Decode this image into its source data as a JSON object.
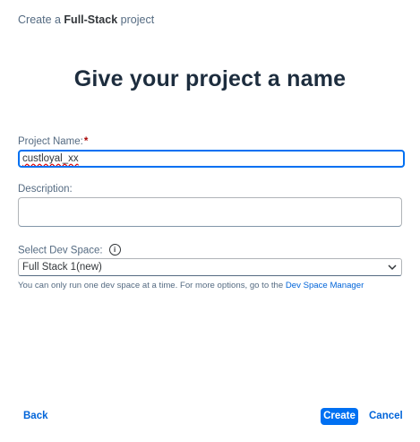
{
  "header": {
    "prefix": "Create a ",
    "bold": "Full-Stack",
    "suffix": " project"
  },
  "page_title": "Give your project a name",
  "project_name": {
    "label": "Project Name:",
    "required_marker": "*",
    "value": "custloyal_xx"
  },
  "description": {
    "label": "Description:",
    "value": ""
  },
  "dev_space": {
    "label": "Select Dev Space:",
    "info_icon": "i",
    "selected": "Full Stack 1(new)",
    "hint_text": "You can only run one dev space at a time. For more options, go to the ",
    "hint_link": "Dev Space Manager"
  },
  "footer": {
    "back": "Back",
    "create": "Create",
    "cancel": "Cancel"
  },
  "colors": {
    "accent": "#0070f2",
    "link": "#0064d9",
    "required": "#aa0808"
  }
}
